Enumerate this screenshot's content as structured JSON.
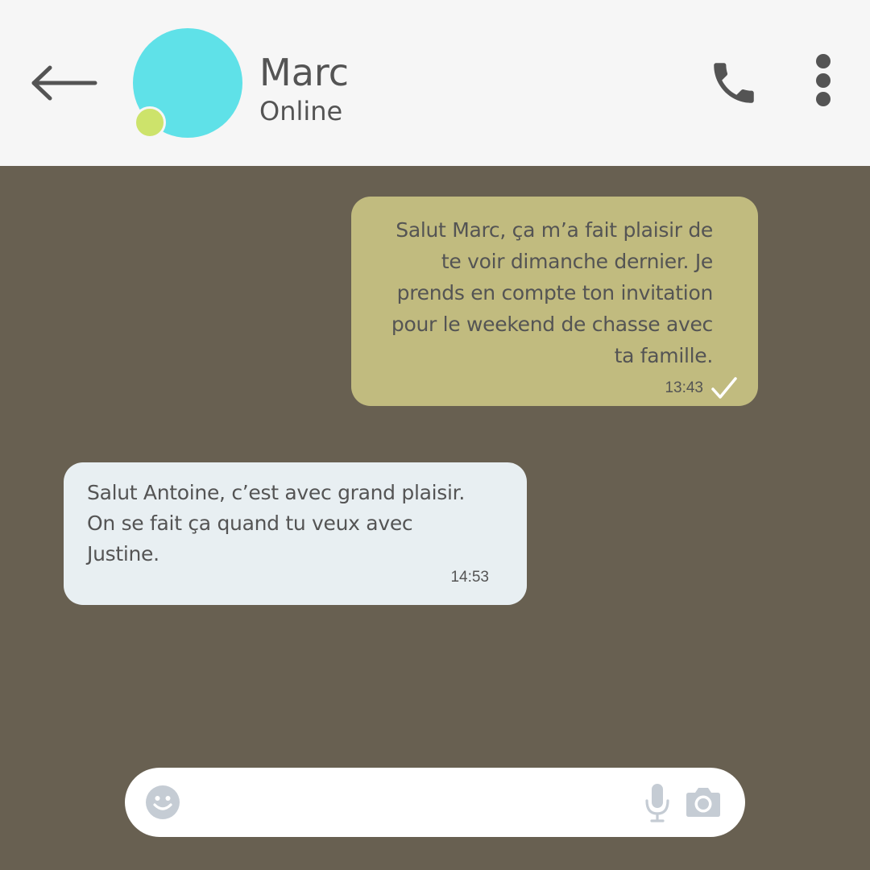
{
  "header": {
    "back_icon": "arrow-left-icon",
    "contact_name": "Marc",
    "contact_status": "Online",
    "avatar_color": "#5fe1e8",
    "presence_color": "#cde36b",
    "call_icon": "phone-icon",
    "menu_icon": "more-vertical-icon"
  },
  "messages": [
    {
      "direction": "outgoing",
      "lines": [
        "Salut Marc, ça m’a fait plaisir de",
        "te voir dimanche dernier. Je",
        "prends en compte ton invitation",
        "pour le weekend de chasse avec",
        "ta famille."
      ],
      "time": "13:43",
      "status_icon": "checkmark-icon",
      "bubble_color": "#c1bb7f"
    },
    {
      "direction": "incoming",
      "lines": [
        "Salut Antoine, c’est avec grand plaisir.",
        "On se fait ça quand tu veux avec",
        "Justine."
      ],
      "time": "14:53",
      "bubble_color": "#e8eff2"
    }
  ],
  "composer": {
    "value": "",
    "emoji_icon": "emoji-icon",
    "mic_icon": "microphone-icon",
    "camera_icon": "camera-icon"
  },
  "colors": {
    "chat_background": "#686051",
    "header_background": "#f6f6f6",
    "text": "#545454",
    "composer_icons": "#c5ccd4"
  }
}
